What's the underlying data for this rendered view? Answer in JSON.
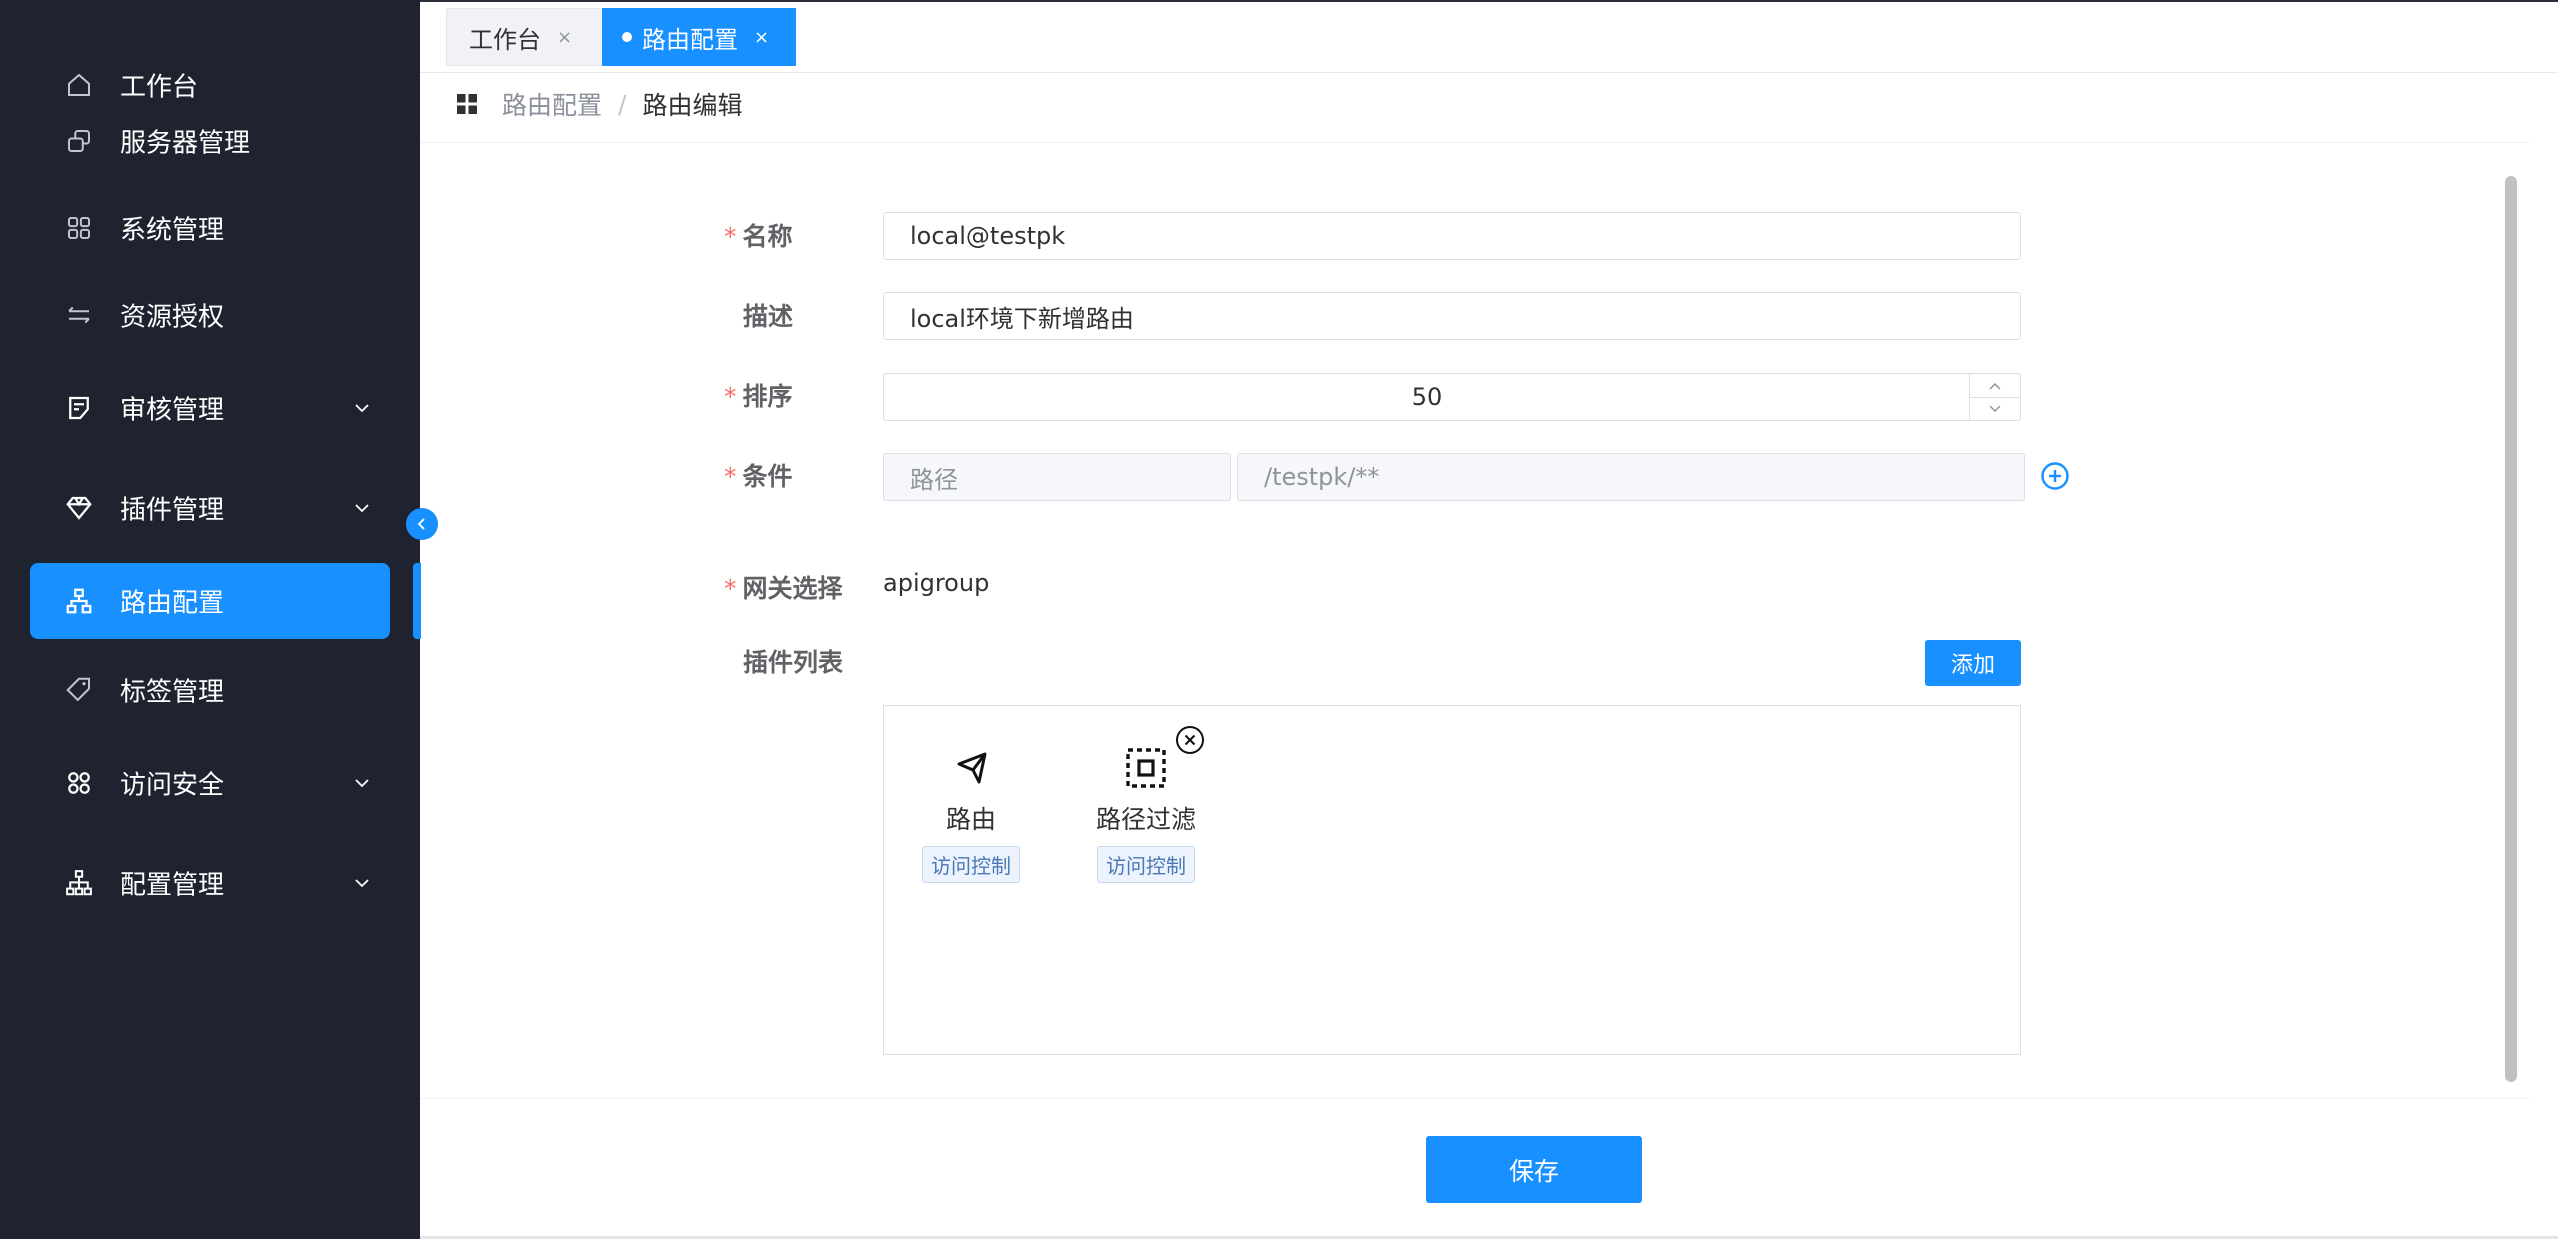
{
  "sidebar": {
    "items": [
      {
        "label": "工作台",
        "icon": "home-icon"
      },
      {
        "label": "服务器管理",
        "icon": "server-icon"
      },
      {
        "label": "系统管理",
        "icon": "apps-grid-icon"
      },
      {
        "label": "资源授权",
        "icon": "transfer-icon"
      },
      {
        "label": "审核管理",
        "icon": "audit-icon",
        "expandable": true
      },
      {
        "label": "插件管理",
        "icon": "diamond-icon",
        "expandable": true
      },
      {
        "label": "路由配置",
        "icon": "route-tree-icon",
        "active": true
      },
      {
        "label": "标签管理",
        "icon": "tag-icon"
      },
      {
        "label": "访问安全",
        "icon": "security-grid-icon",
        "expandable": true
      },
      {
        "label": "配置管理",
        "icon": "org-chart-icon",
        "expandable": true
      }
    ]
  },
  "tabs": [
    {
      "label": "工作台",
      "close": "×"
    },
    {
      "label": "路由配置",
      "close": "×",
      "active": true
    }
  ],
  "breadcrumb": {
    "parent": "路由配置",
    "separator": "/",
    "current": "路由编辑"
  },
  "form": {
    "name": {
      "label": "名称",
      "value": "local@testpk",
      "required": "*"
    },
    "description": {
      "label": "描述",
      "value": "local环境下新增路由"
    },
    "order": {
      "label": "排序",
      "value": "50",
      "required": "*"
    },
    "condition": {
      "label": "条件",
      "type_placeholder": "路径",
      "value": "/testpk/**",
      "required": "*"
    },
    "gateway": {
      "label": "网关选择",
      "value": "apigroup",
      "required": "*"
    },
    "plugins": {
      "label": "插件列表",
      "add_label": "添加",
      "items": [
        {
          "name": "路由",
          "tag": "访问控制",
          "icon": "send-arrow-icon"
        },
        {
          "name": "路径过滤",
          "tag": "访问控制",
          "icon": "path-filter-icon"
        }
      ]
    }
  },
  "footer": {
    "save_label": "保存"
  },
  "colors": {
    "primary": "#1890ff",
    "sidebar_bg": "#1f2330",
    "required": "#f56c6c"
  }
}
